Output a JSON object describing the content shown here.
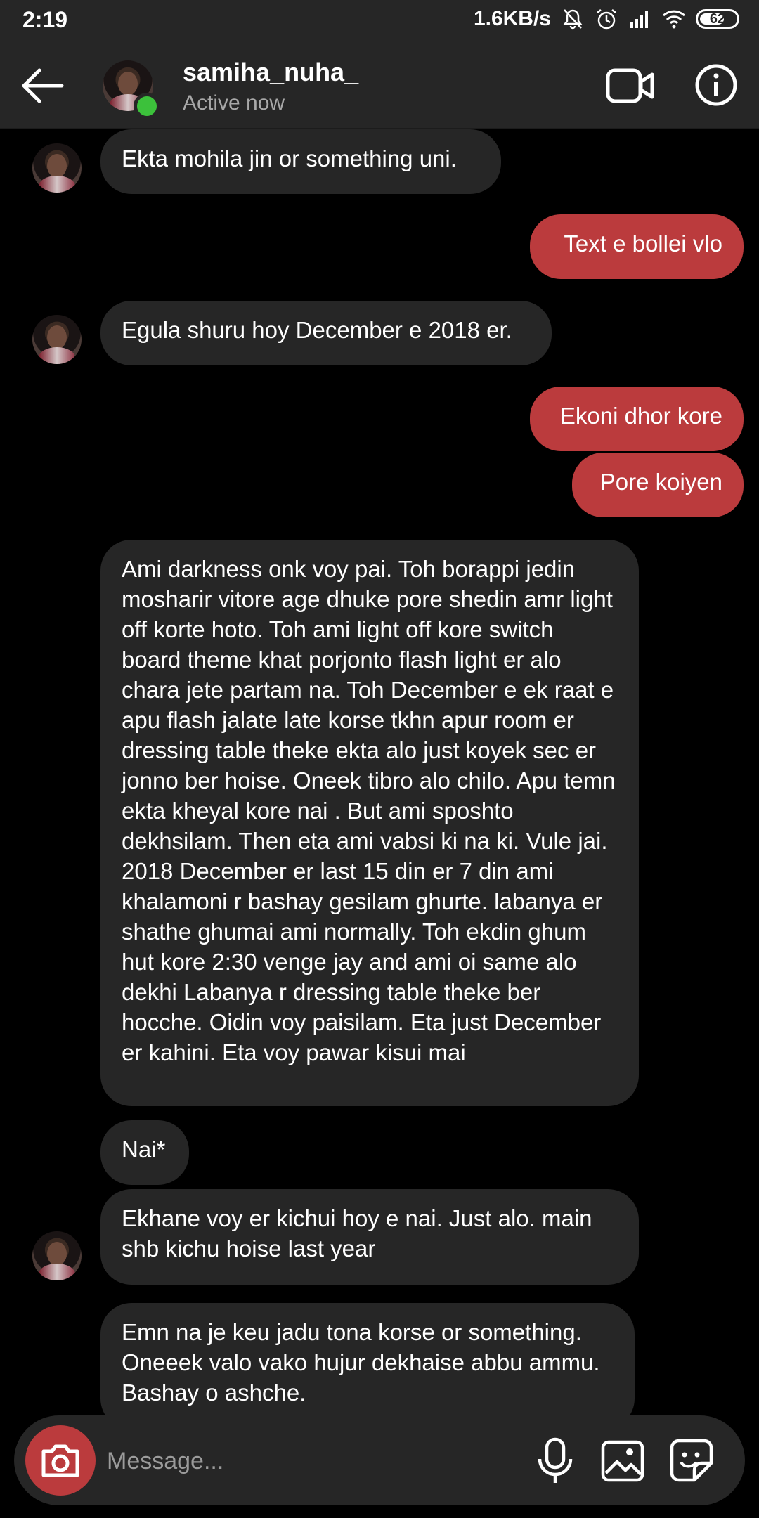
{
  "status_bar": {
    "time": "2:19",
    "network_speed": "1.6KB/s",
    "battery": "62",
    "icons": [
      "mute-bell-icon",
      "alarm-icon",
      "signal-icon",
      "wifi-icon",
      "battery-icon"
    ]
  },
  "header": {
    "username": "samiha_nuha_",
    "status": "Active now",
    "icons": [
      "back-arrow-icon",
      "video-call-icon",
      "info-icon"
    ]
  },
  "messages": [
    {
      "dir": "in",
      "text": "Ekta mohila jin or something uni."
    },
    {
      "dir": "out",
      "text": "Text e bollei vlo"
    },
    {
      "dir": "in",
      "text": "Egula shuru hoy December e 2018 er."
    },
    {
      "dir": "out",
      "text": "Ekoni dhor kore"
    },
    {
      "dir": "out",
      "text": "Pore koiyen"
    },
    {
      "dir": "in",
      "text": "Ami darkness onk voy pai. Toh borappi jedin mosharir vitore age dhuke pore shedin amr light off korte hoto. Toh ami light off kore switch board theme khat porjonto flash light er alo chara jete partam na. Toh December e ek raat e apu flash jalate late korse tkhn apur room er dressing table theke ekta alo just koyek sec er jonno ber hoise. Oneek tibro alo chilo. Apu temn ekta kheyal kore nai . But ami sposhto dekhsilam. Then eta ami vabsi ki na ki. Vule jai. 2018 December er last 15 din er 7 din ami khalamoni r bashay gesilam ghurte.  labanya er shathe ghumai ami normally. Toh ekdin ghum hut kore 2:30 venge jay and ami oi same alo dekhi Labanya r dressing table theke ber hocche. Oidin voy paisilam. Eta just December er kahini. Eta voy pawar kisui mai"
    },
    {
      "dir": "in",
      "text": "Nai*"
    },
    {
      "dir": "in",
      "text": "Ekhane voy er kichui hoy e nai. Just alo. main shb kichu hoise last year"
    },
    {
      "dir": "in",
      "text": "Emn na je keu jadu tona korse or something. Oneeek valo vako hujur dekhaise abbu ammu. Bashay o ashche."
    }
  ],
  "composer": {
    "placeholder": "Message...",
    "icons": [
      "camera-icon",
      "microphone-icon",
      "gallery-icon",
      "sticker-icon"
    ]
  },
  "colors": {
    "background": "#000000",
    "bar": "#262626",
    "incoming_bubble": "#262626",
    "outgoing_bubble": "#bb3b3d",
    "online": "#3cc13b"
  }
}
